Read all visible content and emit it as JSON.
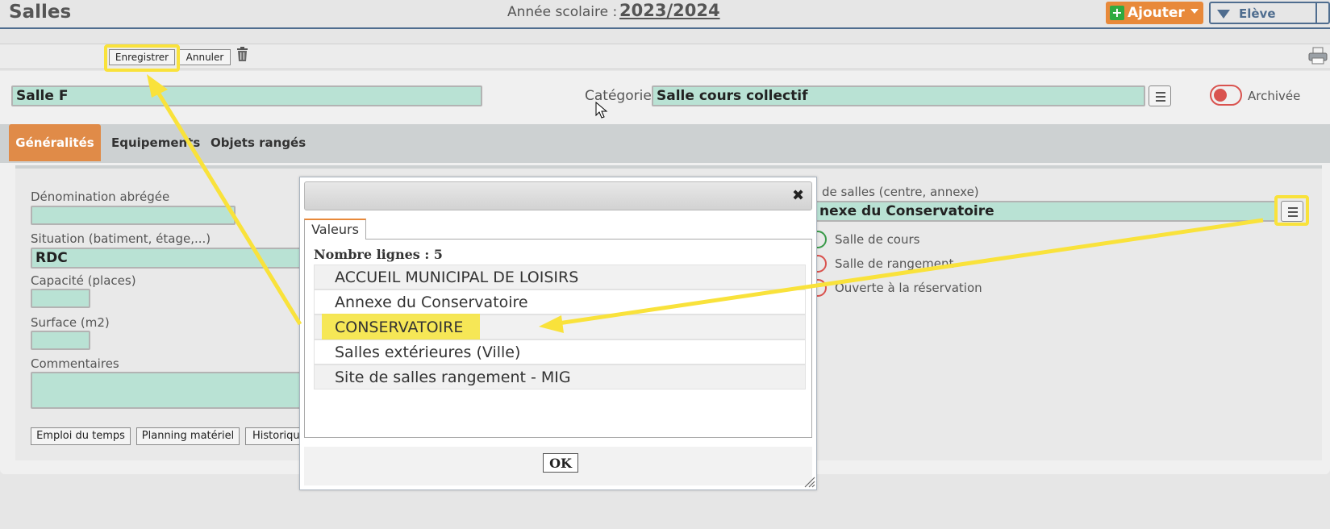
{
  "header": {
    "title": "Salles",
    "year_label": "Année scolaire :",
    "year_value": "2023/2024",
    "add_label": "Ajouter",
    "student_label": "Elève"
  },
  "toolbar": {
    "save_label": "Enregistrer",
    "cancel_label": "Annuler"
  },
  "form": {
    "name_value": "Salle F",
    "category_label": "Catégorie",
    "category_value": "Salle cours collectif",
    "archived_label": "Archivée",
    "tabs": [
      "Généralités",
      "Equipements",
      "Objets rangés"
    ],
    "short_name_label": "Dénomination abrégée",
    "situation_label": "Situation (batiment, étage,...)",
    "situation_value": "RDC",
    "capacity_label": "Capacité (places)",
    "surface_label": "Surface (m2)",
    "comments_label": "Commentaires",
    "group_label_partial": "de salles (centre, annexe)",
    "group_value_partial": "nexe du Conservatoire",
    "radios": [
      "Salle de cours",
      "Salle de rangement",
      "Ouverte à la réservation"
    ],
    "bottom_buttons": [
      "Emploi du temps",
      "Planning matériel",
      "Historique"
    ]
  },
  "modal": {
    "tab_label": "Valeurs",
    "row_count": "Nombre lignes : 5",
    "rows": [
      "ACCUEIL MUNICIPAL DE LOISIRS",
      "Annexe du Conservatoire",
      "CONSERVATOIRE",
      "Salles extérieures (Ville)",
      "Site de salles rangement - MIG"
    ],
    "highlighted_row": "CONSERVATOIRE",
    "ok_label": "OK",
    "close_icon": "close-icon"
  },
  "colors": {
    "accent_orange": "#e8893a",
    "input_green": "#b9e2d4",
    "annotation_yellow": "#f9e23b",
    "radio_green": "#3a9a4a",
    "radio_red": "#d9534f"
  }
}
